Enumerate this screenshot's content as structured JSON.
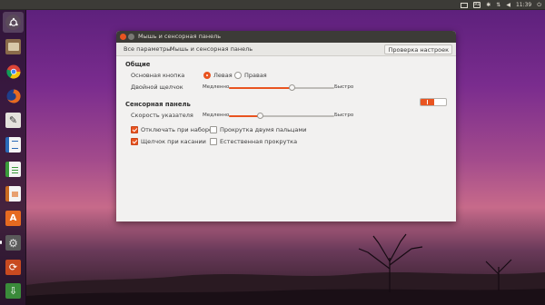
{
  "top_panel": {
    "keyboard_layout": "Ru",
    "clock": "11:39"
  },
  "launcher": {
    "items": [
      {
        "name": "dash-home",
        "color": "#6a5a6a",
        "glyph": ""
      },
      {
        "name": "files",
        "color": "#8a6a4a",
        "glyph": "▭"
      },
      {
        "name": "chromium",
        "color": "#4a86c8",
        "glyph": "◉"
      },
      {
        "name": "firefox",
        "color": "#e66a20",
        "glyph": "●"
      },
      {
        "name": "text-editor",
        "color": "#d8d6d0",
        "glyph": "✎"
      },
      {
        "name": "writer",
        "color": "#2a6ab8",
        "glyph": "▤"
      },
      {
        "name": "calc",
        "color": "#3a9a3a",
        "glyph": "▦"
      },
      {
        "name": "impress",
        "color": "#c86a20",
        "glyph": "▣"
      },
      {
        "name": "software-center",
        "color": "#e66a20",
        "glyph": "A"
      },
      {
        "name": "system-settings",
        "color": "#6a6a6a",
        "glyph": "⚙"
      },
      {
        "name": "update-manager",
        "color": "#c84a20",
        "glyph": "⟳"
      },
      {
        "name": "downloads",
        "color": "#3a8a3a",
        "glyph": "⇩"
      }
    ]
  },
  "window": {
    "title": "Мышь и сенсорная панель",
    "toolbar": {
      "all_settings": "Все параметры",
      "current_page": "Мышь и сенсорная панель",
      "test_button": "Проверка настроек"
    },
    "general": {
      "heading": "Общие",
      "primary_button_label": "Основная кнопка",
      "left_option": "Левая",
      "right_option": "Правая",
      "primary_selected": "left",
      "double_click_label": "Двойной щелчок",
      "slow": "Медленно",
      "fast": "Быстро",
      "double_click_value": 0.6
    },
    "touchpad": {
      "heading": "Сенсорная панель",
      "enabled": true,
      "pointer_speed_label": "Скорость указателя",
      "slow": "Медленно",
      "fast": "Быстро",
      "pointer_speed_value": 0.3,
      "options": [
        {
          "label": "Отключать при наборе",
          "checked": true
        },
        {
          "label": "Прокрутка двумя пальцами",
          "checked": false
        },
        {
          "label": "Щелчок при касании",
          "checked": true
        },
        {
          "label": "Естественная прокрутка",
          "checked": false
        }
      ]
    }
  }
}
